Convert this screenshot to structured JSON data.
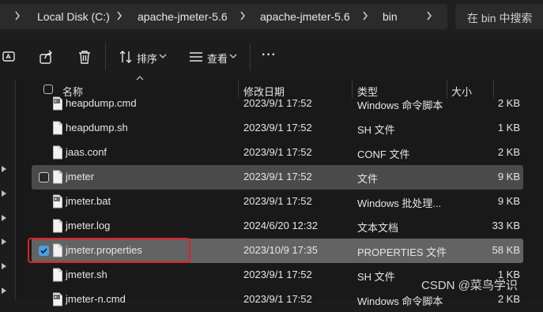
{
  "breadcrumb": [
    "Local Disk (C:)",
    "apache-jmeter-5.6",
    "apache-jmeter-5.6",
    "bin"
  ],
  "search": {
    "placeholder": "在 bin 中搜索"
  },
  "toolbar": {
    "sort_label": "排序",
    "view_label": "查看",
    "more_label": "···"
  },
  "columns": {
    "name": "名称",
    "modified": "修改日期",
    "type": "类型",
    "size": "大小"
  },
  "files": [
    {
      "name": "heapdump.cmd",
      "modified": "2023/9/1 17:52",
      "type": "Windows 命令脚本",
      "size": "2 KB",
      "icon": "script-file-icon",
      "state": "normal"
    },
    {
      "name": "heapdump.sh",
      "modified": "2023/9/1 17:52",
      "type": "SH 文件",
      "size": "1 KB",
      "icon": "file-icon",
      "state": "normal"
    },
    {
      "name": "jaas.conf",
      "modified": "2023/9/1 17:52",
      "type": "CONF 文件",
      "size": "2 KB",
      "icon": "file-icon",
      "state": "normal"
    },
    {
      "name": "jmeter",
      "modified": "2023/9/1 17:52",
      "type": "文件",
      "size": "9 KB",
      "icon": "file-icon",
      "state": "hover"
    },
    {
      "name": "jmeter.bat",
      "modified": "2023/9/1 17:52",
      "type": "Windows 批处理...",
      "size": "9 KB",
      "icon": "script-file-icon",
      "state": "normal"
    },
    {
      "name": "jmeter.log",
      "modified": "2024/6/20 12:32",
      "type": "文本文档",
      "size": "33 KB",
      "icon": "file-icon",
      "state": "normal"
    },
    {
      "name": "jmeter.properties",
      "modified": "2023/10/9 17:35",
      "type": "PROPERTIES 文件",
      "size": "58 KB",
      "icon": "file-icon",
      "state": "selected"
    },
    {
      "name": "jmeter.sh",
      "modified": "2023/9/1 17:52",
      "type": "SH 文件",
      "size": "1 KB",
      "icon": "file-icon",
      "state": "normal"
    },
    {
      "name": "jmeter-n.cmd",
      "modified": "2023/9/1 17:52",
      "type": "Windows 命令脚本",
      "size": "2 KB",
      "icon": "script-file-icon",
      "state": "normal"
    }
  ],
  "watermark": "CSDN @菜鸟学识",
  "colors": {
    "selection_check": "#4c9fe8",
    "annotation_box": "#e0202a",
    "selected_row": "#636363",
    "hover_row": "#4a4a4a"
  }
}
